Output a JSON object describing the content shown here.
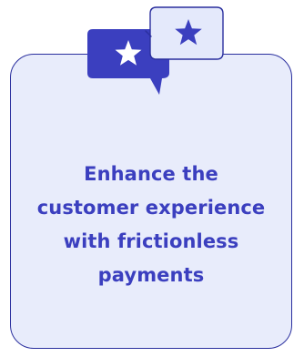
{
  "card": {
    "message_lines": [
      "Enhance the",
      "customer experience",
      "with frictionless",
      "payments"
    ]
  },
  "icons": {
    "front_bubble": "chat-bubble-star-icon",
    "back_bubble": "outline-chat-bubble-star-icon"
  },
  "colors": {
    "accent": "#3b3fbf",
    "border": "#2a2f9e",
    "card_fill": "#e8ecfb",
    "back_bubble_fill": "#e4e9fb"
  }
}
